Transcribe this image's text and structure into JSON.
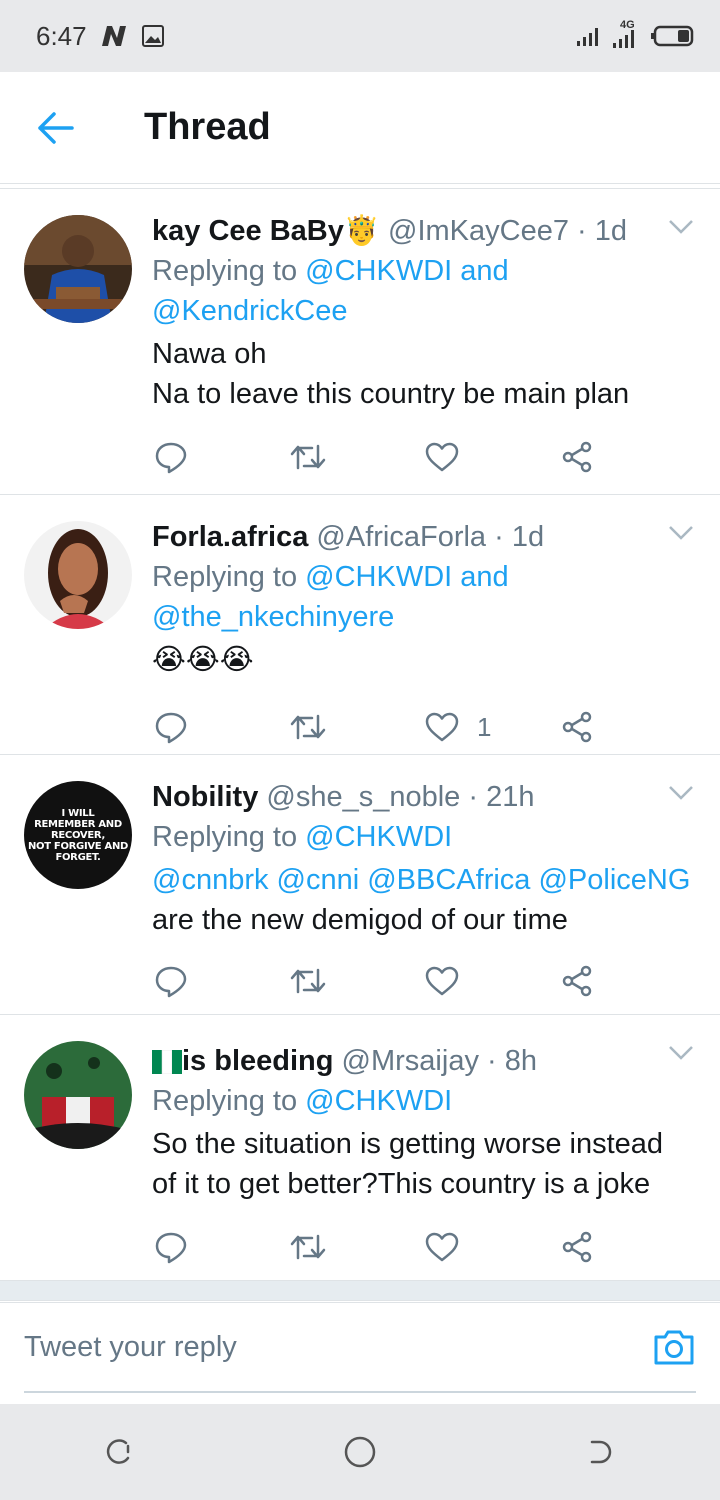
{
  "status_bar": {
    "time": "6:47",
    "network": "4G"
  },
  "header": {
    "title": "Thread"
  },
  "tweets": [
    {
      "display_name": "kay Cee BaBy",
      "handle": "@ImKayCee7",
      "time": "1d",
      "replying_prefix": "Replying to",
      "replying_to": [
        "@CHKWDI",
        "@KendrickCee"
      ],
      "replying_joiner": "and",
      "text_line1": "Nawa oh",
      "text_line2": "Na to leave this country be main plan",
      "like_count": ""
    },
    {
      "display_name": "Forla.africa",
      "handle": "@AfricaForla",
      "time": "1d",
      "replying_prefix": "Replying to",
      "replying_to": [
        "@CHKWDI",
        "@the_nkechinyere"
      ],
      "replying_joiner": "and",
      "text_line1": "😭😭😭",
      "like_count": "1"
    },
    {
      "display_name": "Nobility",
      "handle": "@she_s_noble",
      "time": "21h",
      "replying_prefix": "Replying to",
      "replying_to": [
        "@CHKWDI"
      ],
      "mentions": "@cnnbrk @cnni @BBCAfrica @PoliceNG",
      "text_line1": "are the new demigod of our time",
      "avatar_text": [
        "I WILL",
        "REMEMBER AND",
        "RECOVER,",
        "NOT FORGIVE AND",
        "FORGET."
      ],
      "like_count": ""
    },
    {
      "display_name": "is bleeding",
      "handle": "@Mrsaijay",
      "time": "8h",
      "replying_prefix": "Replying to",
      "replying_to": [
        "@CHKWDI"
      ],
      "text_line1": "So the situation is getting worse instead",
      "text_line2": "of it to get better?This country is a joke",
      "like_count": ""
    }
  ],
  "compose": {
    "placeholder": "Tweet your reply"
  },
  "colors": {
    "accent": "#1da1f2",
    "muted": "#657786",
    "text": "#14171a"
  }
}
